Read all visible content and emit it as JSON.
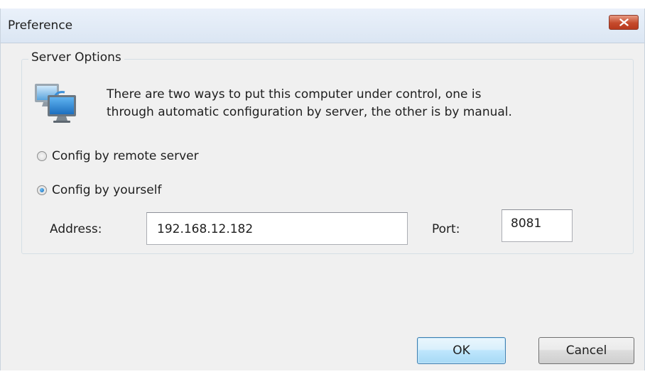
{
  "window": {
    "title": "Preference"
  },
  "group": {
    "title": "Server Options",
    "description_line1": "There are two ways to put this computer under control, one is",
    "description_line2": "through automatic configuration by server, the other is by manual."
  },
  "options": {
    "remote_label": "Config by remote server",
    "manual_label": "Config by yourself",
    "selected": "manual"
  },
  "fields": {
    "address_label": "Address:",
    "address_value": "192.168.12.182",
    "port_label": "Port:",
    "port_value": "8081"
  },
  "buttons": {
    "ok": "OK",
    "cancel": "Cancel"
  },
  "icons": {
    "close": "close-icon",
    "computer": "networked-computers-icon"
  },
  "colors": {
    "close_button": "#c54a2c",
    "default_button_border": "#3c7fb1"
  }
}
